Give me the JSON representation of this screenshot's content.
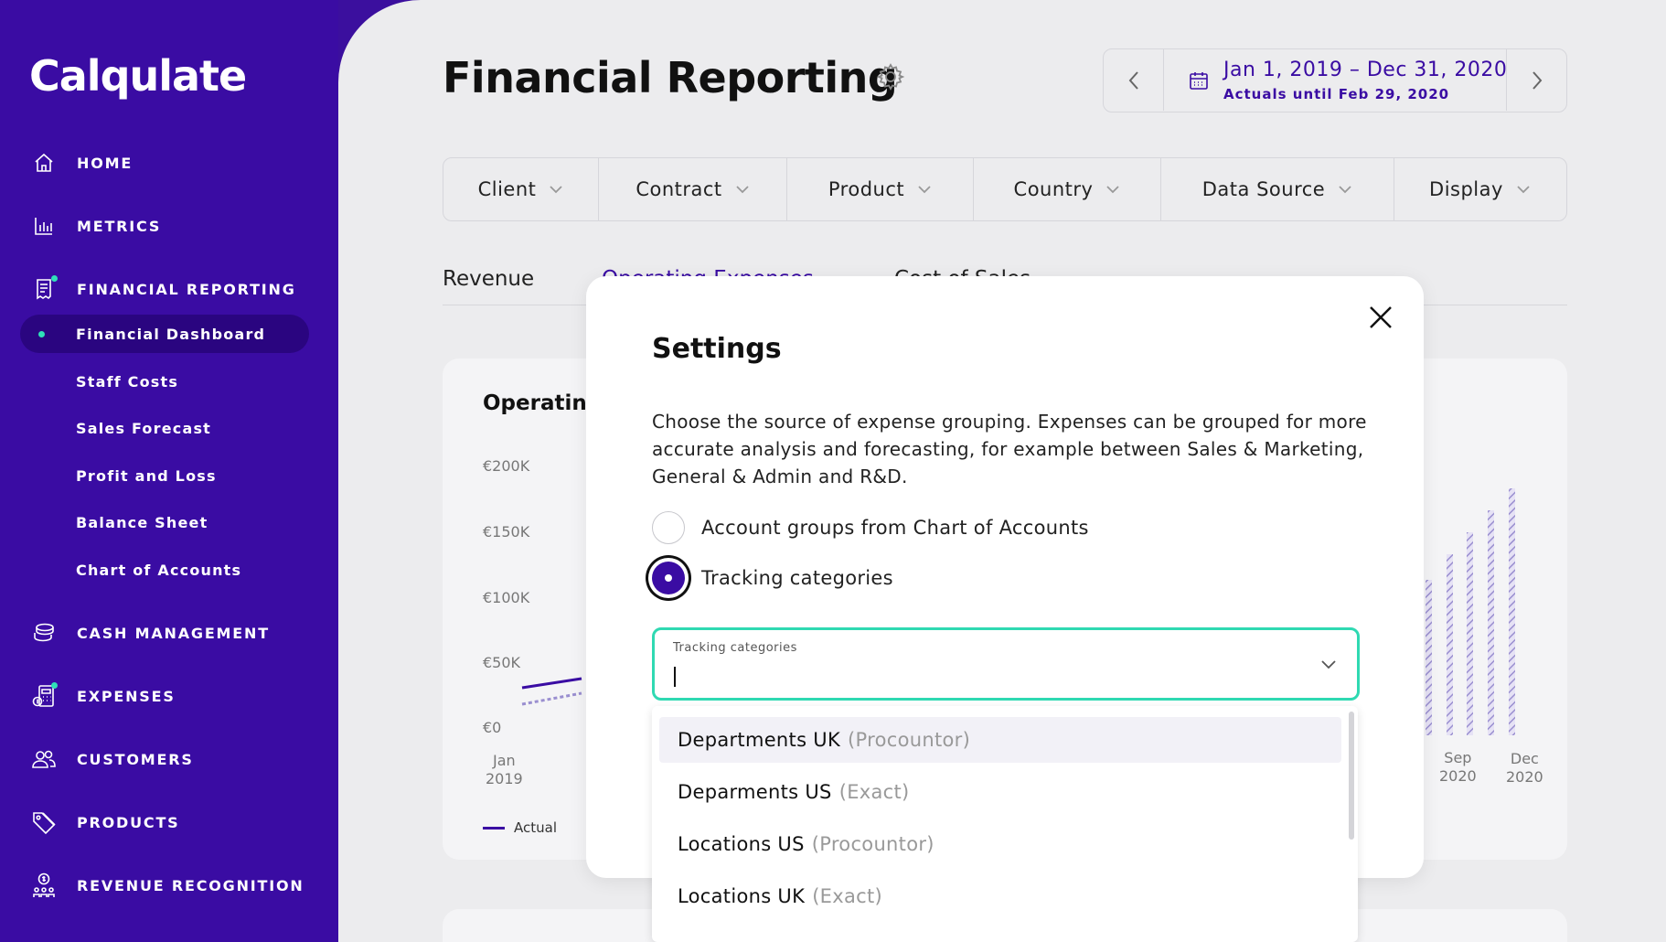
{
  "app": {
    "logo": "Calqulate"
  },
  "sidebar": {
    "items": [
      {
        "label": "HOME"
      },
      {
        "label": "METRICS"
      },
      {
        "label": "FINANCIAL REPORTING"
      },
      {
        "label": "CASH MANAGEMENT"
      },
      {
        "label": "EXPENSES"
      },
      {
        "label": "CUSTOMERS"
      },
      {
        "label": "PRODUCTS"
      },
      {
        "label": "REVENUE RECOGNITION"
      }
    ],
    "sub_items": [
      {
        "label": "Financial Dashboard"
      },
      {
        "label": "Staff Costs"
      },
      {
        "label": "Sales Forecast"
      },
      {
        "label": "Profit and Loss"
      },
      {
        "label": "Balance Sheet"
      },
      {
        "label": "Chart of Accounts"
      }
    ]
  },
  "header": {
    "title": "Financial Reporting",
    "date_range": "Jan 1, 2019 – Dec 31, 2020",
    "actuals": "Actuals until Feb 29, 2020"
  },
  "filters": [
    {
      "label": "Client"
    },
    {
      "label": "Contract"
    },
    {
      "label": "Product"
    },
    {
      "label": "Country"
    },
    {
      "label": "Data Source"
    },
    {
      "label": "Display"
    }
  ],
  "tabs": [
    {
      "label": "Revenue"
    },
    {
      "label": "Operating Expenses"
    },
    {
      "label": "Cost of Sales"
    }
  ],
  "card": {
    "title": "Operating",
    "y_ticks": [
      "€200K",
      "€150K",
      "€100K",
      "€50K",
      "€0"
    ],
    "x_ticks": [
      {
        "month": "Jan",
        "year": "2019"
      },
      {
        "month": "Sep",
        "year": "2020"
      },
      {
        "month": "Dec",
        "year": "2020"
      }
    ],
    "legend": "Actual"
  },
  "modal": {
    "title": "Settings",
    "description": "Choose the source of expense grouping. Expenses can be grouped for more accurate analysis and forecasting, for example between Sales & Marketing, General & Admin and R&D.",
    "options": [
      {
        "label": "Account groups from Chart of Accounts",
        "checked": false
      },
      {
        "label": "Tracking categories",
        "checked": true
      }
    ],
    "select": {
      "label": "Tracking categories",
      "value": ""
    },
    "dropdown": [
      {
        "name": "Departments UK",
        "source": "(Procountor)"
      },
      {
        "name": "Deparments US",
        "source": "(Exact)"
      },
      {
        "name": "Locations US",
        "source": "(Procountor)"
      },
      {
        "name": "Locations UK",
        "source": "(Exact)"
      }
    ]
  },
  "colors": {
    "brand": "#3a0ca3",
    "accent": "#2fe0b8",
    "background": "#ececee"
  }
}
